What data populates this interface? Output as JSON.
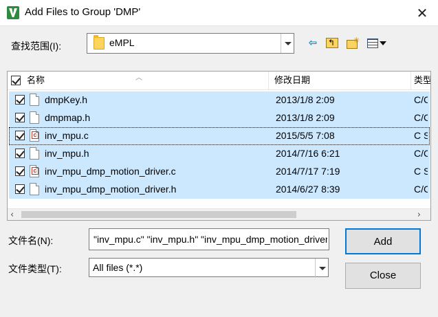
{
  "window": {
    "title": "Add Files to Group 'DMP'",
    "close_glyph": "✕"
  },
  "lookin": {
    "label": "查找范围(I):",
    "value": "eMPL"
  },
  "toolbar": {
    "back_glyph": "⇦"
  },
  "list": {
    "columns": {
      "name": "名称",
      "date": "修改日期",
      "type": "类型"
    },
    "rows": [
      {
        "name": "dmpKey.h",
        "date": "2013/1/8 2:09",
        "type": "C/C++",
        "kind": "h"
      },
      {
        "name": "dmpmap.h",
        "date": "2013/1/8 2:09",
        "type": "C/C++",
        "kind": "h"
      },
      {
        "name": "inv_mpu.c",
        "date": "2015/5/5 7:08",
        "type": "C Source",
        "kind": "c"
      },
      {
        "name": "inv_mpu.h",
        "date": "2014/7/16 6:21",
        "type": "C/C++",
        "kind": "h"
      },
      {
        "name": "inv_mpu_dmp_motion_driver.c",
        "date": "2014/7/17 7:19",
        "type": "C Source",
        "kind": "c"
      },
      {
        "name": "inv_mpu_dmp_motion_driver.h",
        "date": "2014/6/27 8:39",
        "type": "C/C++",
        "kind": "h"
      }
    ]
  },
  "filename": {
    "label": "文件名(N):",
    "value": "\"inv_mpu.c\" \"inv_mpu.h\" \"inv_mpu_dmp_motion_driver.c\" \"inv_mpu_dmp_motion_driver.h\""
  },
  "filetype": {
    "label": "文件类型(T):",
    "value": "All files (*.*)"
  },
  "buttons": {
    "add": "Add",
    "close": "Close"
  }
}
